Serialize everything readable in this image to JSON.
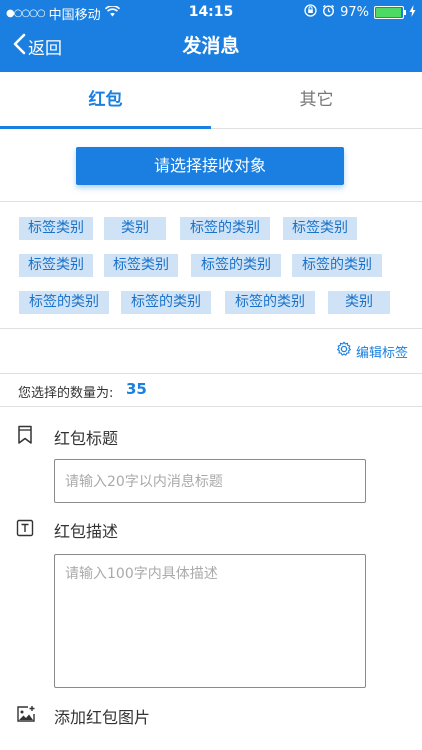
{
  "status": {
    "signal": "●○○○○",
    "carrier": "中国移动",
    "time": "14:15",
    "battery_text": "97%",
    "battery_level": 0.97
  },
  "nav": {
    "back_label": "返回",
    "title": "发消息"
  },
  "tabs": [
    {
      "label": "红包",
      "active": true
    },
    {
      "label": "其它",
      "active": false
    }
  ],
  "select_button_label": "请选择接收对象",
  "tags": [
    "标签类别",
    "类别",
    "标签的类别",
    "标签类别",
    "标签类别",
    "标签类别",
    "标签的类别",
    "标签的类别",
    "标签的类别",
    "标签的类别",
    "标签的类别",
    "类别"
  ],
  "edit_tags_label": "编辑标签",
  "count": {
    "label": "您选择的数量为:",
    "value": "35"
  },
  "form": {
    "title_label": "红包标题",
    "title_placeholder": "请输入20字以内消息标题",
    "desc_label": "红包描述",
    "desc_placeholder": "请输入100字内具体描述",
    "image_label": "添加红包图片"
  },
  "colors": {
    "primary": "#1a7fe0",
    "tag_bg": "#cfe2f6",
    "tag_text": "#1a73c9",
    "background": "#f2f2f2"
  }
}
